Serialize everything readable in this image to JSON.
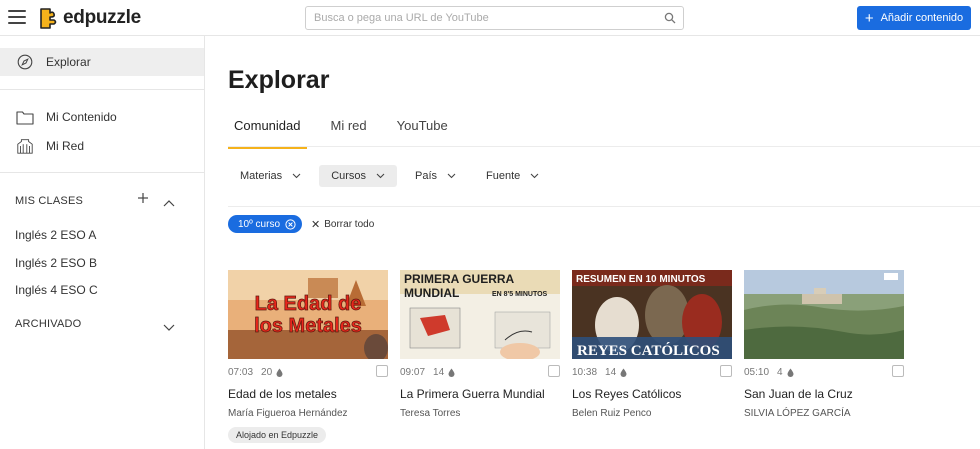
{
  "header": {
    "logo_text": "edpuzzle",
    "search_placeholder": "Busca o pega una URL de YouTube",
    "add_button_label": "Añadir contenido",
    "brand_color": "#f5b21b",
    "accent_color": "#1a6ce0"
  },
  "sidebar": {
    "explore_label": "Explorar",
    "my_content_label": "Mi Contenido",
    "my_network_label": "Mi Red",
    "classes_section": "MIS CLASES",
    "classes": [
      "Inglés 2 ESO A",
      "Inglés 2 ESO B",
      "Inglés 4 ESO C"
    ],
    "archived_section": "ARCHIVADO"
  },
  "main": {
    "title": "Explorar",
    "tabs": [
      "Comunidad",
      "Mi red",
      "YouTube"
    ],
    "active_tab": "Comunidad",
    "filters": [
      "Materias",
      "Cursos",
      "País",
      "Fuente"
    ],
    "active_filter": "Cursos",
    "active_chip": "10º curso",
    "clear_all_label": "Borrar todo"
  },
  "videos": [
    {
      "duration": "07:03",
      "questions": "20",
      "title": "Edad de los metales",
      "author": "María Figueroa Hernández",
      "badge": "Alojado en Edpuzzle",
      "thumb_text_1": "La Edad de",
      "thumb_text_2": "los Metales"
    },
    {
      "duration": "09:07",
      "questions": "14",
      "title": "La Primera Guerra Mundial",
      "author": "Teresa Torres",
      "thumb_text_1": "PRIMERA GUERRA",
      "thumb_text_2": "MUNDIAL",
      "thumb_text_3": "EN 8'5 MINUTOS"
    },
    {
      "duration": "10:38",
      "questions": "14",
      "title": "Los Reyes Católicos",
      "author": "Belen Ruiz Penco",
      "thumb_text_1": "RESUMEN EN 10 MINUTOS",
      "thumb_text_2": "REYES CATÓLICOS"
    },
    {
      "duration": "05:10",
      "questions": "4",
      "title": "San Juan de la Cruz",
      "author": "SILVIA LÓPEZ GARCÍA"
    }
  ]
}
